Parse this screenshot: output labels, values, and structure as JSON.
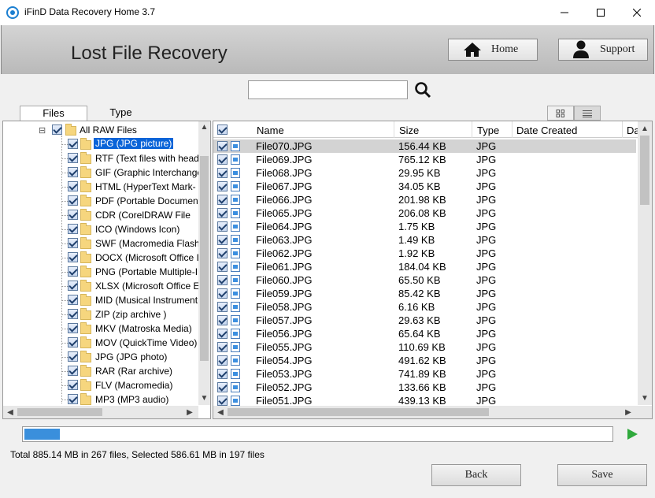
{
  "window": {
    "title": "iFinD Data Recovery Home 3.7"
  },
  "header": {
    "page_title": "Lost File Recovery",
    "home_label": "Home",
    "support_label": "Support"
  },
  "search": {
    "value": "",
    "placeholder": ""
  },
  "tabs": {
    "files": "Files",
    "type": "Type"
  },
  "tree": {
    "root_label": "All RAW Files",
    "items": [
      {
        "label": "JPG (JPG picture)",
        "selected": true
      },
      {
        "label": "RTF (Text files with heade"
      },
      {
        "label": "GIF (Graphic Interchange"
      },
      {
        "label": "HTML (HyperText Mark-"
      },
      {
        "label": "PDF (Portable Document"
      },
      {
        "label": "CDR (CorelDRAW File"
      },
      {
        "label": "ICO (Windows Icon)"
      },
      {
        "label": "SWF (Macromedia Flash)"
      },
      {
        "label": "DOCX (Microsoft Office I"
      },
      {
        "label": "PNG (Portable Multiple-I"
      },
      {
        "label": "XLSX (Microsoft Office Ex"
      },
      {
        "label": "MID (Musical Instrument"
      },
      {
        "label": "ZIP (zip archive )"
      },
      {
        "label": "MKV (Matroska Media)"
      },
      {
        "label": "MOV (QuickTime Video)"
      },
      {
        "label": "JPG (JPG photo)"
      },
      {
        "label": "RAR (Rar archive)"
      },
      {
        "label": "FLV (Macromedia)"
      },
      {
        "label": "MP3 (MP3 audio)"
      }
    ]
  },
  "file_list": {
    "columns": [
      "Name",
      "Size",
      "Type",
      "Date Created",
      "Da"
    ],
    "rows": [
      {
        "name": "File070.JPG",
        "size": "156.44 KB",
        "type": "JPG"
      },
      {
        "name": "File069.JPG",
        "size": "765.12 KB",
        "type": "JPG"
      },
      {
        "name": "File068.JPG",
        "size": "29.95 KB",
        "type": "JPG"
      },
      {
        "name": "File067.JPG",
        "size": "34.05 KB",
        "type": "JPG"
      },
      {
        "name": "File066.JPG",
        "size": "201.98 KB",
        "type": "JPG"
      },
      {
        "name": "File065.JPG",
        "size": "206.08 KB",
        "type": "JPG"
      },
      {
        "name": "File064.JPG",
        "size": "1.75 KB",
        "type": "JPG"
      },
      {
        "name": "File063.JPG",
        "size": "1.49 KB",
        "type": "JPG"
      },
      {
        "name": "File062.JPG",
        "size": "1.92 KB",
        "type": "JPG"
      },
      {
        "name": "File061.JPG",
        "size": "184.04 KB",
        "type": "JPG"
      },
      {
        "name": "File060.JPG",
        "size": "65.50 KB",
        "type": "JPG"
      },
      {
        "name": "File059.JPG",
        "size": "85.42 KB",
        "type": "JPG"
      },
      {
        "name": "File058.JPG",
        "size": "6.16 KB",
        "type": "JPG"
      },
      {
        "name": "File057.JPG",
        "size": "29.63 KB",
        "type": "JPG"
      },
      {
        "name": "File056.JPG",
        "size": "65.64 KB",
        "type": "JPG"
      },
      {
        "name": "File055.JPG",
        "size": "110.69 KB",
        "type": "JPG"
      },
      {
        "name": "File054.JPG",
        "size": "491.62 KB",
        "type": "JPG"
      },
      {
        "name": "File053.JPG",
        "size": "741.89 KB",
        "type": "JPG"
      },
      {
        "name": "File052.JPG",
        "size": "133.66 KB",
        "type": "JPG"
      },
      {
        "name": "File051.JPG",
        "size": "439.13 KB",
        "type": "JPG"
      }
    ]
  },
  "progress": {
    "percent": 6
  },
  "status_text": "Total 885.14 MB in 267 files,  Selected 586.61 MB in 197 files",
  "buttons": {
    "back": "Back",
    "save": "Save"
  },
  "colors": {
    "selection": "#0a64d8",
    "progress": "#3a8fdc",
    "play": "#2fa93c"
  }
}
